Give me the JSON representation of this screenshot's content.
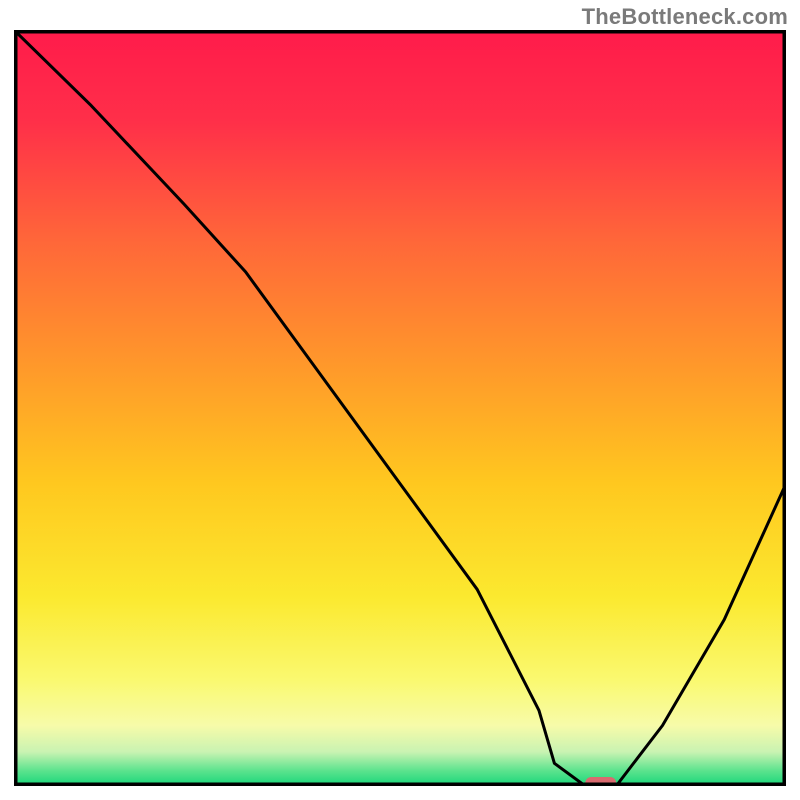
{
  "watermark": "TheBottleneck.com",
  "chart_data": {
    "type": "line",
    "title": "",
    "xlabel": "",
    "ylabel": "",
    "xlim": [
      0,
      100
    ],
    "ylim": [
      0,
      100
    ],
    "grid": false,
    "legend": false,
    "series": [
      {
        "name": "bottleneck-curve",
        "x": [
          0,
          10,
          22,
          30,
          40,
          50,
          60,
          68,
          70,
          74,
          78,
          84,
          92,
          100
        ],
        "values": [
          100,
          90,
          77,
          68,
          54,
          40,
          26,
          10,
          3,
          0,
          0,
          8,
          22,
          40
        ]
      }
    ],
    "marker": {
      "x_start": 74,
      "x_end": 78,
      "y": 0,
      "color": "#d96a6f"
    },
    "background_gradient_stops": [
      {
        "offset": 0.0,
        "color": "#ff1b4b"
      },
      {
        "offset": 0.12,
        "color": "#ff2f49"
      },
      {
        "offset": 0.28,
        "color": "#ff6739"
      },
      {
        "offset": 0.45,
        "color": "#ff9a2a"
      },
      {
        "offset": 0.6,
        "color": "#ffc81f"
      },
      {
        "offset": 0.75,
        "color": "#fbe92f"
      },
      {
        "offset": 0.86,
        "color": "#faf970"
      },
      {
        "offset": 0.92,
        "color": "#f7fba9"
      },
      {
        "offset": 0.955,
        "color": "#c9f3b2"
      },
      {
        "offset": 0.98,
        "color": "#5be38d"
      },
      {
        "offset": 1.0,
        "color": "#17d67a"
      }
    ],
    "border_color": "#000000"
  }
}
